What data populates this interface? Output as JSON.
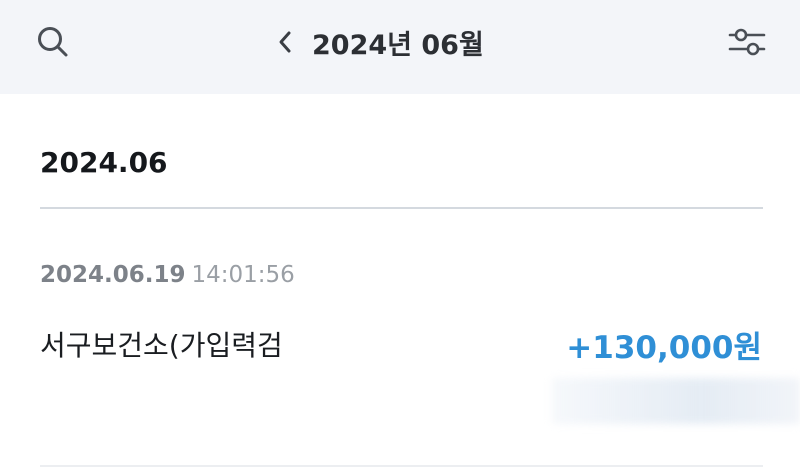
{
  "header": {
    "search_icon": "search-icon",
    "prev_icon": "chevron-left-icon",
    "month_title": "2024년 06월",
    "filter_icon": "sliders-icon"
  },
  "section": {
    "title": "2024.06"
  },
  "transactions": [
    {
      "date": "2024.06.19",
      "time": "14:01:56",
      "title": "서구보건소(가입력검",
      "amount": "+130,000원",
      "amount_color": "#2f8fd6"
    }
  ]
}
